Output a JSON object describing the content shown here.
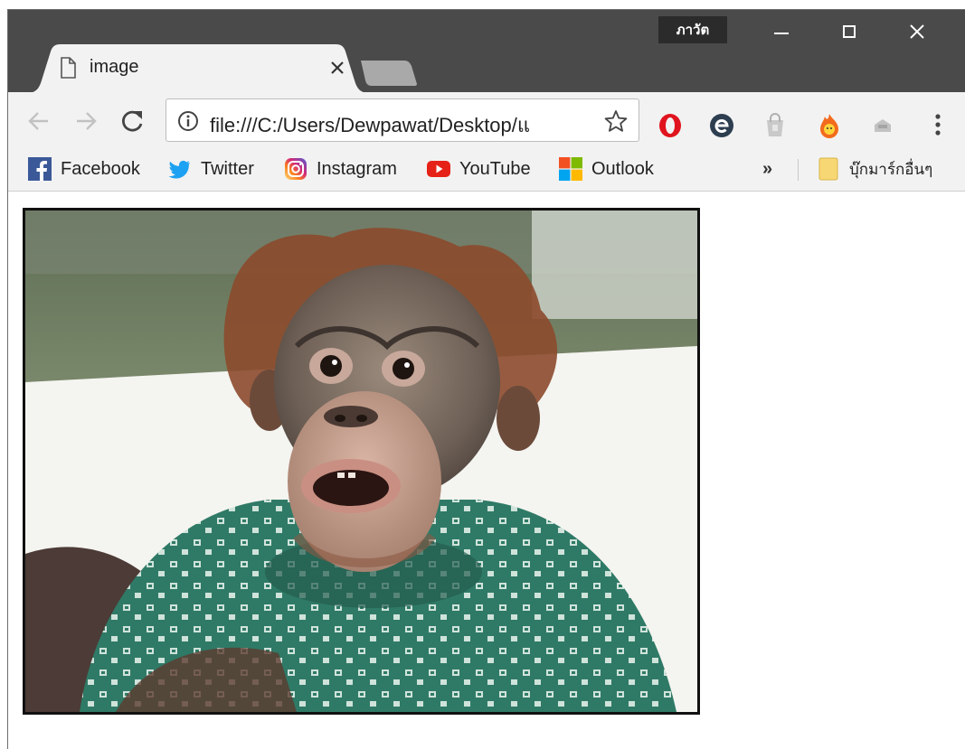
{
  "window": {
    "profile_badge": "ภาวัต",
    "controls": [
      "minimize",
      "maximize",
      "close"
    ]
  },
  "tab": {
    "title": "image",
    "icon": "document-icon"
  },
  "toolbar": {
    "url": "file:///C:/Users/Dewpawat/Desktop/แ",
    "extensions": [
      "opera-icon",
      "e-extension-icon",
      "shopping-bag-icon",
      "fire-icon",
      "gray-extension-icon"
    ]
  },
  "bookmarks": {
    "items": [
      {
        "label": "Facebook",
        "icon": "facebook-icon",
        "color": "#3b5998"
      },
      {
        "label": "Twitter",
        "icon": "twitter-icon",
        "color": "#1da1f2"
      },
      {
        "label": "Instagram",
        "icon": "instagram-icon",
        "color": "#c13584"
      },
      {
        "label": "YouTube",
        "icon": "youtube-icon",
        "color": "#e62117"
      },
      {
        "label": "Outlook",
        "icon": "windows-logo-icon",
        "color": "#0078d7"
      }
    ],
    "overflow": "»",
    "other_bookmarks": "บุ๊กมาร์กอื่นๆ"
  },
  "content": {
    "image": "orangutan-photo"
  }
}
